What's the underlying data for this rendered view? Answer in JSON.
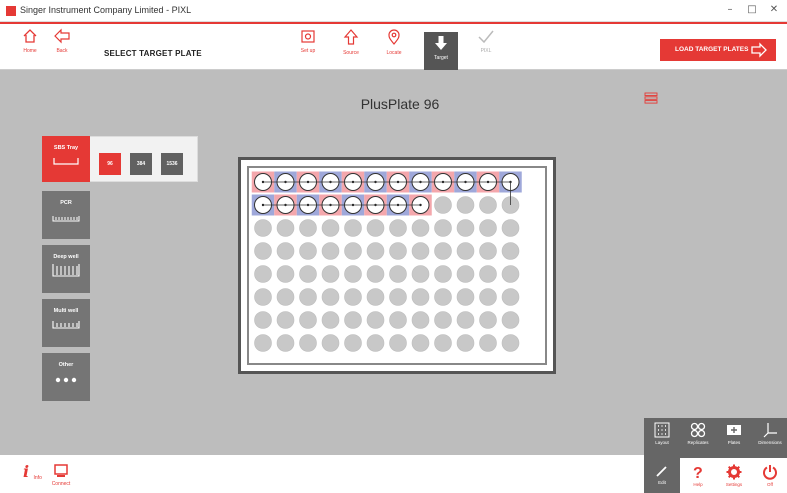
{
  "window": {
    "title": "Singer Instrument Company Limited - PIXL",
    "minimize": "–",
    "maximize": "□",
    "close": "✕"
  },
  "toolbar": {
    "home": "Home",
    "back": "Back",
    "screen_title": "SELECT TARGET PLATE",
    "steps": [
      {
        "label": "Set up",
        "icon": "setup-icon"
      },
      {
        "label": "Source",
        "icon": "source-icon"
      },
      {
        "label": "Locate",
        "icon": "locate-icon"
      },
      {
        "label": "Target",
        "icon": "target-icon"
      },
      {
        "label": "PIXL",
        "icon": "pixl-icon"
      }
    ],
    "load_button": "LOAD TARGET PLATES"
  },
  "main": {
    "plate_name": "PlusPlate 96",
    "tray_types": [
      "SBS Tray",
      "PCR",
      "Deep well",
      "Multi well",
      "Other"
    ],
    "formats": [
      "96",
      "384",
      "1536"
    ],
    "plate": {
      "rows": 8,
      "cols": 12,
      "selected_row1": 12,
      "selected_row2": 8
    }
  },
  "bottom_tools": [
    "Layout",
    "Replicates",
    "Plates",
    "Dimensions",
    "Edit",
    "Help",
    "Settings",
    "Off"
  ],
  "bottom_left": {
    "info": "Info",
    "connect": "Connect"
  },
  "colors": {
    "accent": "#e53935",
    "pink": "#f4a7ac",
    "blue": "#9fa8da"
  }
}
